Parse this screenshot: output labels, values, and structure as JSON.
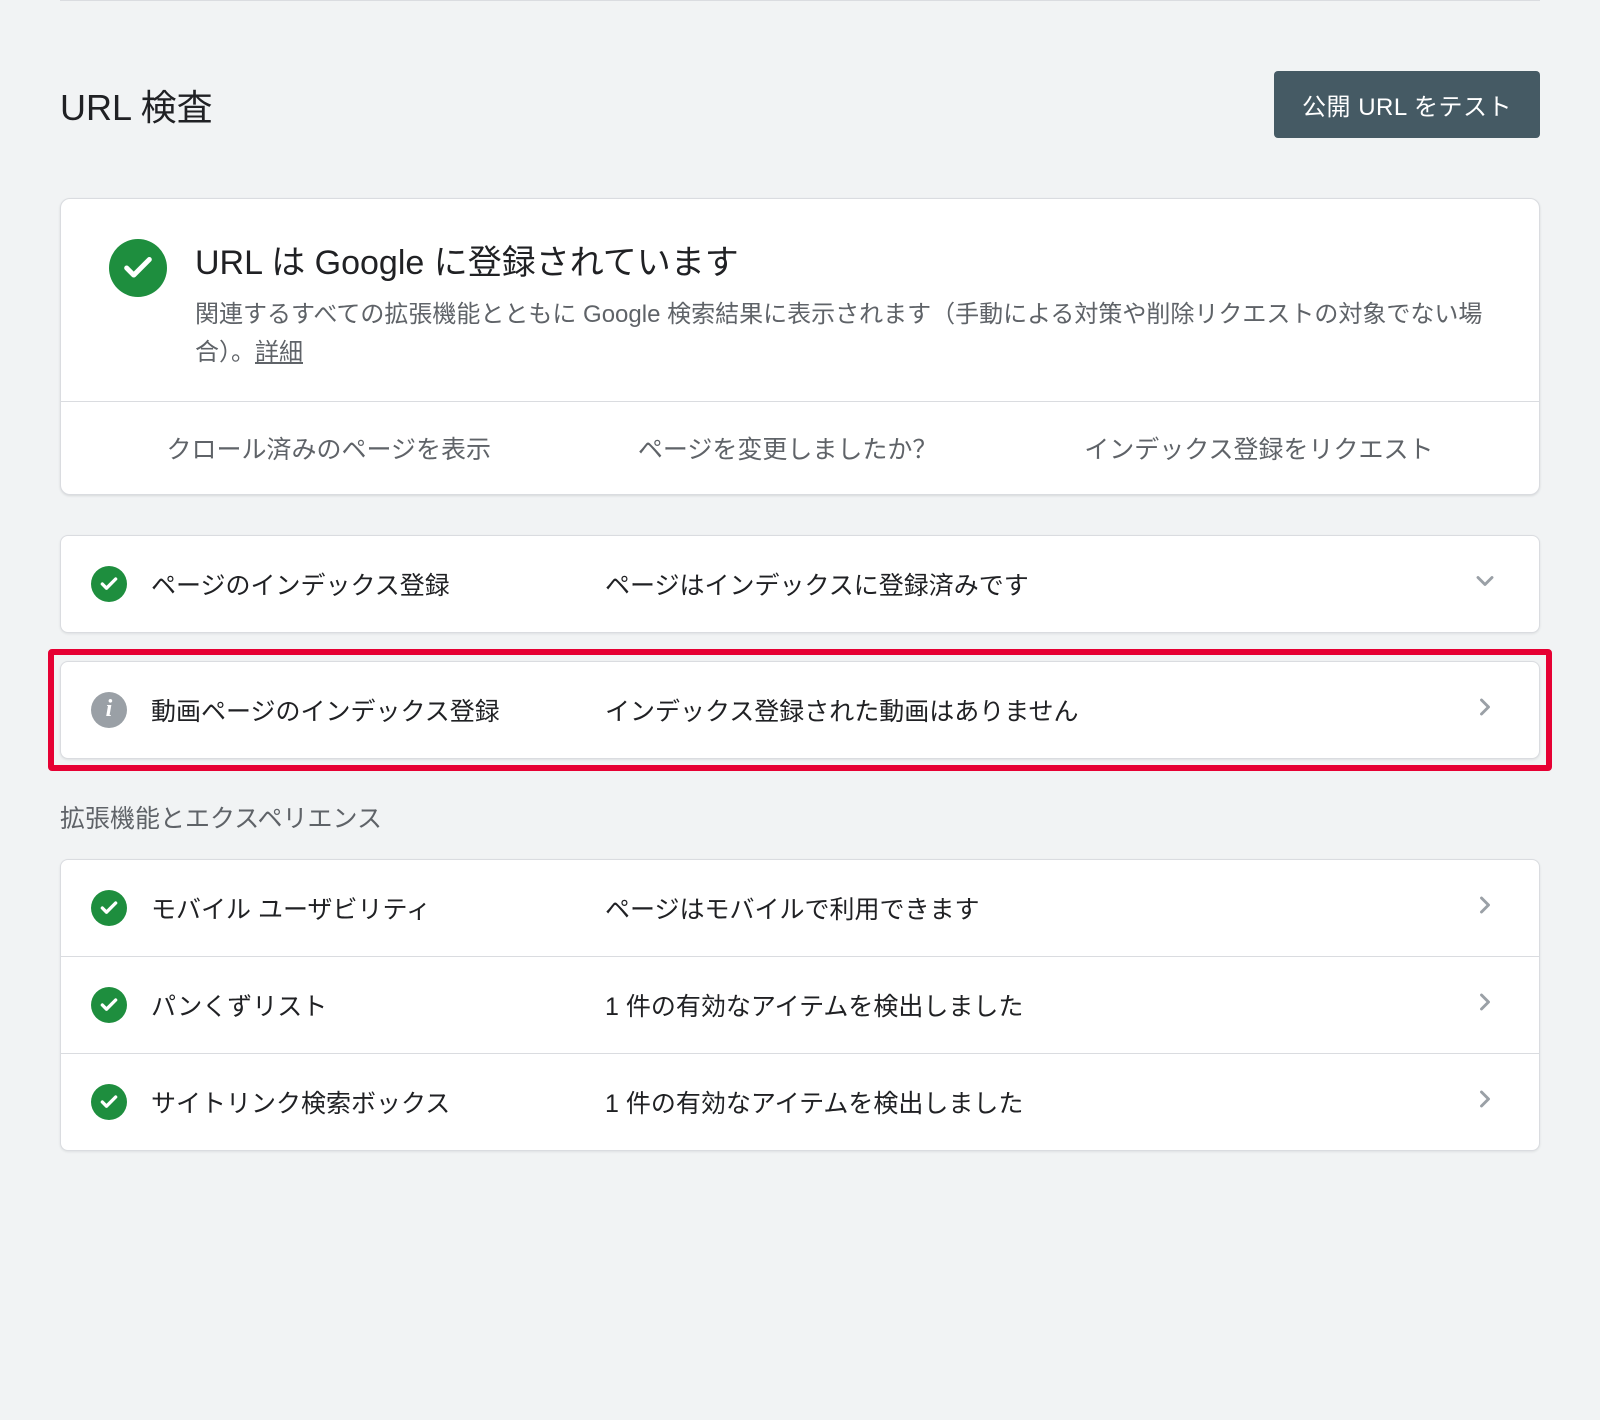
{
  "header": {
    "title": "URL 検査",
    "test_button": "公開 URL をテスト"
  },
  "status_card": {
    "title": "URL は Google に登録されています",
    "description_part1": "関連するすべての拡張機能とともに Google 検索結果に表示されます（手動による対策や削除リクエストの対象でない場合）。",
    "details_link": "詳細"
  },
  "actions": {
    "view_crawled": "クロール済みのページを表示",
    "page_changed": "ページを変更しましたか？",
    "request_indexing": "インデックス登録をリクエスト"
  },
  "rows": {
    "indexing": {
      "label": "ページのインデックス登録",
      "value": "ページはインデックスに登録済みです"
    },
    "video_indexing": {
      "label": "動画ページのインデックス登録",
      "value": "インデックス登録された動画はありません"
    }
  },
  "section_label": "拡張機能とエクスペリエンス",
  "extension_rows": {
    "mobile": {
      "label": "モバイル ユーザビリティ",
      "value": "ページはモバイルで利用できます"
    },
    "breadcrumb": {
      "label": "パンくずリスト",
      "value": "1 件の有効なアイテムを検出しました"
    },
    "sitelinks": {
      "label": "サイトリンク検索ボックス",
      "value": "1 件の有効なアイテムを検出しました"
    }
  }
}
